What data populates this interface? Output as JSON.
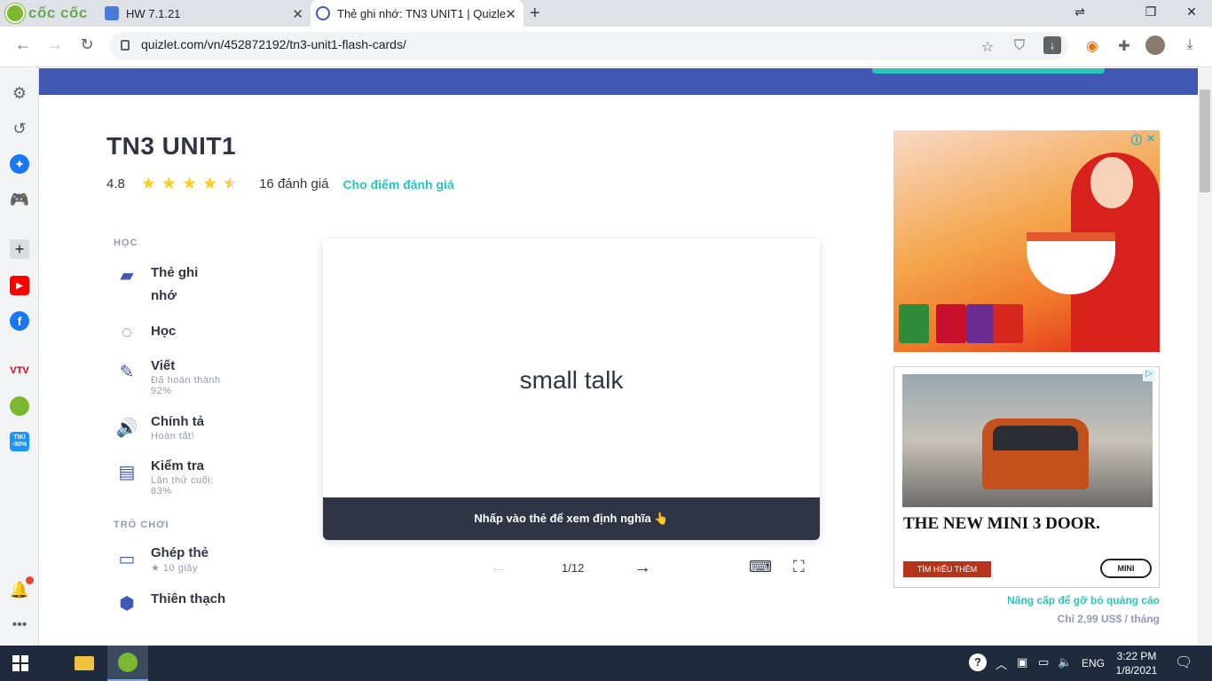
{
  "browser": {
    "brand_name": "cốc cốc",
    "tabs": [
      {
        "title": "HW 7.1.21"
      },
      {
        "title": "Thẻ ghi nhớ: TN3 UNIT1 | Quizlet"
      }
    ],
    "url": "quizlet.com/vn/452872192/tn3-unit1-flash-cards/"
  },
  "sidebar_badges": {
    "tiki": "TIKI -50%"
  },
  "set": {
    "title": "TN3 UNIT1",
    "rating_value": "4.8",
    "rating_stars": 4.5,
    "reviews": "16 đánh giá",
    "rate_link": "Cho điểm đánh giá"
  },
  "study": {
    "section_learn": "HỌC",
    "modes": [
      {
        "label": "Thẻ ghi nhớ",
        "sub": ""
      },
      {
        "label": "Học",
        "sub": ""
      },
      {
        "label": "Viết",
        "sub": "Đã hoàn thành 92%"
      },
      {
        "label": "Chính tả",
        "sub": "Hoàn tất!"
      },
      {
        "label": "Kiểm tra",
        "sub": "Lần thử cuối: 83%"
      }
    ],
    "section_games": "TRÒ CHƠI",
    "games": [
      {
        "label": "Ghép thẻ",
        "sub": "★ 10 giây"
      },
      {
        "label": "Thiên thạch",
        "sub": ""
      }
    ]
  },
  "flashcard": {
    "term": "small talk",
    "hint": "Nhấp vào thẻ để xem định nghĩa 👆",
    "counter": "1/12"
  },
  "ads": {
    "ad2_headline": "THE NEW MINI 3 DOOR.",
    "ad2_cta": "TÌM HIỂU THÊM",
    "ad2_logo": "MINI",
    "upgrade": "Nâng cấp để gỡ bỏ quảng cáo",
    "price": "Chỉ 2,99 US$ / tháng"
  },
  "taskbar": {
    "language": "ENG",
    "time": "3:22 PM",
    "date": "1/8/2021"
  },
  "colors": {
    "quizlet_blue": "#4257b2",
    "quizlet_teal": "#2ac5b8",
    "star": "#ffcd1f"
  }
}
